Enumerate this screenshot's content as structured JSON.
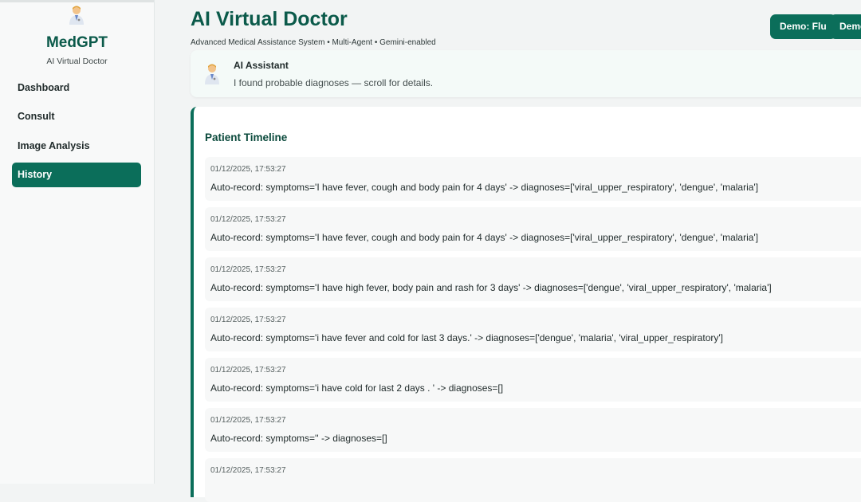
{
  "sidebar": {
    "brand_name": "MedGPT",
    "brand_subtitle": "AI Virtual Doctor",
    "items": [
      {
        "label": "Dashboard",
        "active": false
      },
      {
        "label": "Consult",
        "active": false
      },
      {
        "label": "Image Analysis",
        "active": false
      },
      {
        "label": "History",
        "active": true
      }
    ]
  },
  "header": {
    "title": "AI Virtual Doctor",
    "subtitle": "Advanced Medical Assistance System • Multi-Agent • Gemini-enabled",
    "demo_buttons": [
      "Demo: Flu",
      "Demo"
    ]
  },
  "assistant": {
    "name": "AI Assistant",
    "message": "I found probable diagnoses — scroll for details."
  },
  "timeline": {
    "title": "Patient Timeline",
    "entries": [
      {
        "time": "01/12/2025, 17:53:27",
        "text": "Auto-record: symptoms='I have fever, cough and body pain for 4 days' -> diagnoses=['viral_upper_respiratory', 'dengue', 'malaria']"
      },
      {
        "time": "01/12/2025, 17:53:27",
        "text": "Auto-record: symptoms='I have fever, cough and body pain for 4 days' -> diagnoses=['viral_upper_respiratory', 'dengue', 'malaria']"
      },
      {
        "time": "01/12/2025, 17:53:27",
        "text": "Auto-record: symptoms='I have high fever, body pain and rash for 3 days' -> diagnoses=['dengue', 'viral_upper_respiratory', 'malaria']"
      },
      {
        "time": "01/12/2025, 17:53:27",
        "text": "Auto-record: symptoms='i have fever and cold for last 3 days.' -> diagnoses=['dengue', 'malaria', 'viral_upper_respiratory']"
      },
      {
        "time": "01/12/2025, 17:53:27",
        "text": "Auto-record: symptoms='i have cold for last 2 days . ' -> diagnoses=[]"
      },
      {
        "time": "01/12/2025, 17:53:27",
        "text": "Auto-record: symptoms='' -> diagnoses=[]"
      },
      {
        "time": "01/12/2025, 17:53:27",
        "text": ""
      }
    ]
  },
  "colors": {
    "accent": "#0b6e5a",
    "title": "#0b5a4a"
  },
  "icons": {
    "brand_avatar": "doctor-avatar-icon",
    "assistant_avatar": "doctor-avatar-icon"
  }
}
